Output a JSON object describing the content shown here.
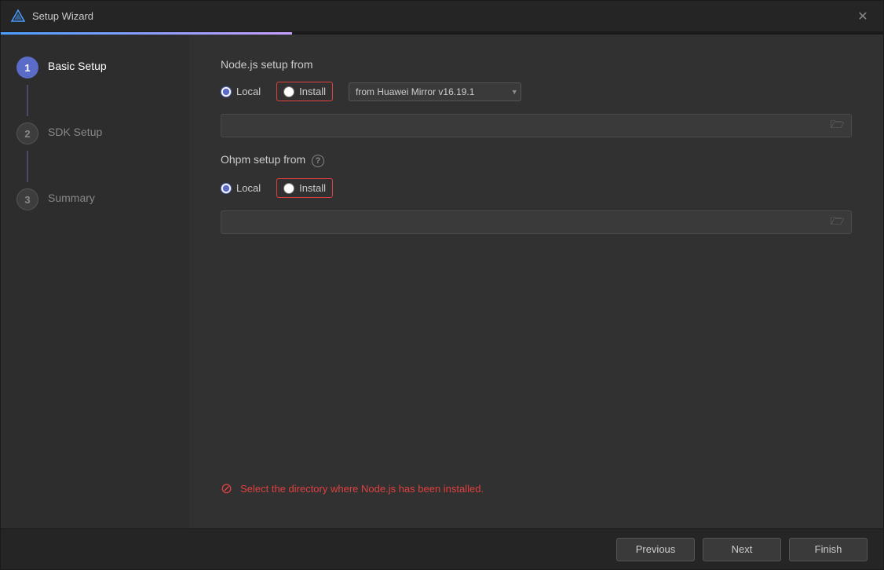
{
  "window": {
    "title": "Setup Wizard"
  },
  "sidebar": {
    "steps": [
      {
        "id": 1,
        "label": "Basic Setup",
        "state": "active"
      },
      {
        "id": 2,
        "label": "SDK Setup",
        "state": "inactive"
      },
      {
        "id": 3,
        "label": "Summary",
        "state": "inactive"
      }
    ]
  },
  "main": {
    "nodejs_section_title": "Node.js setup from",
    "nodejs_local_label": "Local",
    "nodejs_install_label": "Install",
    "nodejs_mirror_option": "from Huawei Mirror v16.19.1",
    "ohpm_section_title": "Ohpm setup from",
    "ohpm_local_label": "Local",
    "ohpm_install_label": "Install",
    "browse_icon": "📁",
    "question_icon": "?",
    "error_message": "Select the directory where Node.js has been installed.",
    "nodejs_selected": "local",
    "ohpm_selected": "local"
  },
  "footer": {
    "previous_label": "Previous",
    "next_label": "Next",
    "finish_label": "Finish"
  }
}
